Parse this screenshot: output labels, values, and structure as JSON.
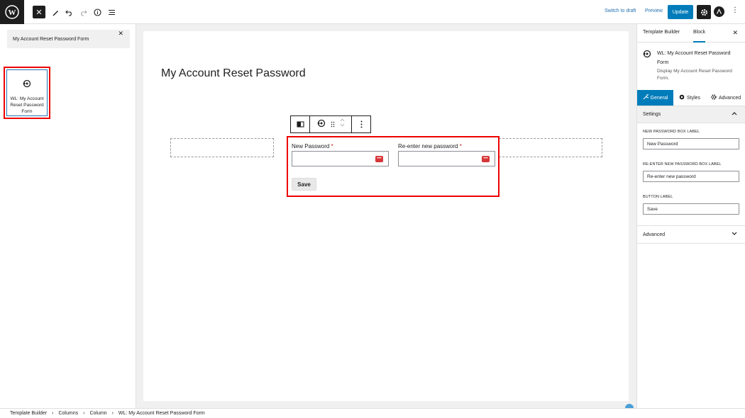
{
  "topbar": {
    "switch_to_draft": "Switch to draft",
    "preview": "Preview",
    "update": "Update"
  },
  "left_panel": {
    "search_value": "My Account Reset Password Form",
    "block_item_label": "WL: My Account Reset Password Form"
  },
  "canvas": {
    "page_title": "My Account Reset Password",
    "form": {
      "new_password_label": "New Password",
      "reenter_label": "Re-enter new password",
      "required_mark": "*",
      "save_label": "Save"
    }
  },
  "right_panel": {
    "tabs": [
      "Template Builder",
      "Block"
    ],
    "block_title": "WL: My Account Reset Password Form",
    "block_desc": "Display My Account Reset Password Form.",
    "sub_tabs": [
      "General",
      "Styles",
      "Advanced"
    ],
    "settings_title": "Settings",
    "fields": [
      {
        "label": "NEW PASSWORD BOX LABEL",
        "value": "New Password"
      },
      {
        "label": "RE-ENTER NEW PASSWORD BOX LABEL",
        "value": "Re-enter new password"
      },
      {
        "label": "BUTTON LABEL",
        "value": "Save"
      }
    ],
    "advanced_title": "Advanced"
  },
  "breadcrumb": [
    "Template Builder",
    "Columns",
    "Column",
    "WL: My Account Reset Password Form"
  ],
  "colors": {
    "accent": "#007cba",
    "highlight": "#e00000",
    "dark": "#1e1e1e"
  }
}
